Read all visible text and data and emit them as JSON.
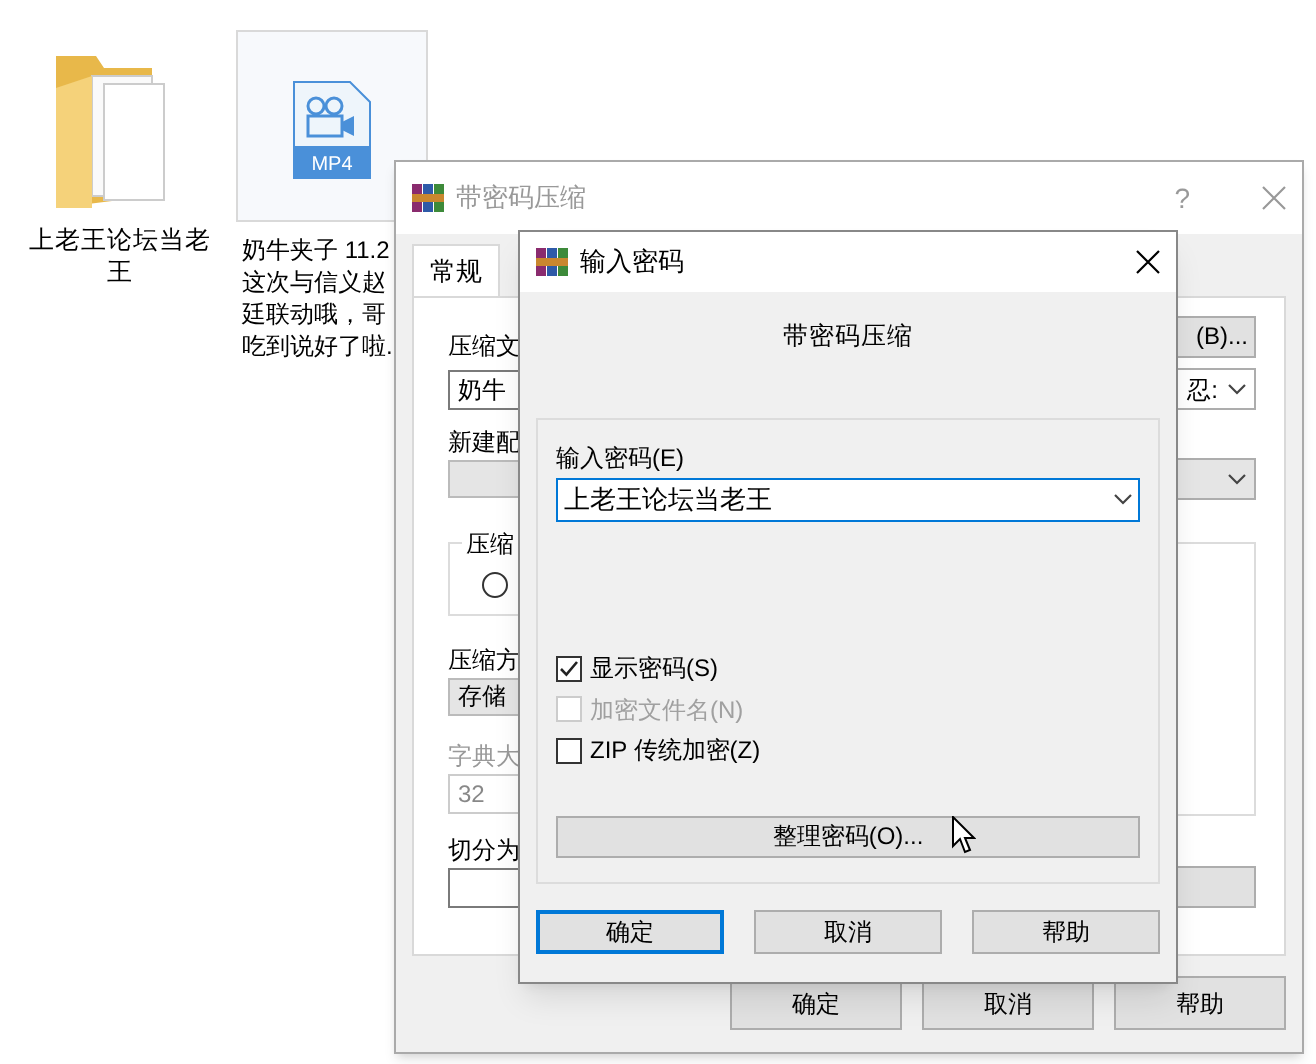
{
  "desktop": {
    "items": [
      {
        "kind": "folder",
        "label_lines": [
          "上老王论坛当老",
          "王"
        ],
        "selected": false
      },
      {
        "kind": "video",
        "badge": "MP4",
        "label_lines": [
          "奶牛夹子 11.2",
          "这次与信义赵",
          "廷联动哦，哥",
          "吃到说好了啦."
        ],
        "selected": true
      }
    ]
  },
  "back_dialog": {
    "title": "带密码压缩",
    "active": false,
    "help": "?",
    "tabs": [
      {
        "label": "常规",
        "selected": true
      }
    ],
    "left": [
      {
        "kind": "label",
        "text": "压缩文"
      },
      {
        "kind": "input",
        "value": "奶牛"
      },
      {
        "kind": "label",
        "text": "新建配"
      },
      {
        "kind": "dropdown"
      },
      {
        "kind": "group",
        "legend": "压缩",
        "selected": false
      },
      {
        "kind": "label",
        "text": "压缩方"
      },
      {
        "kind": "dropdown",
        "value": "存储"
      },
      {
        "kind": "label",
        "text": "字典大",
        "disabled": true
      },
      {
        "kind": "input",
        "value": "32",
        "disabled": true
      },
      {
        "kind": "label",
        "text": "切分为"
      },
      {
        "kind": "input"
      }
    ],
    "right": [
      {
        "kind": "button",
        "label": "(B)..."
      },
      {
        "kind": "dropdown",
        "value": "忍:"
      },
      {
        "kind": "dropdown"
      },
      {
        "kind": "group"
      },
      {
        "kind": "button"
      }
    ],
    "buttons": [
      {
        "label": "确定",
        "default": false
      },
      {
        "label": "取消",
        "default": false
      },
      {
        "label": "帮助",
        "default": false
      }
    ]
  },
  "front_dialog": {
    "title": "输入密码",
    "active": true,
    "heading": "带密码压缩",
    "password_label": "输入密码(E)",
    "password": "上老王论坛当老王",
    "options": [
      {
        "label": "显示密码(S)",
        "checked": true,
        "disabled": false
      },
      {
        "label": "加密文件名(N)",
        "checked": false,
        "disabled": true
      },
      {
        "label": "ZIP 传统加密(Z)",
        "checked": false,
        "disabled": false
      }
    ],
    "organize_button": "整理密码(O)...",
    "buttons": [
      {
        "label": "确定",
        "default": true
      },
      {
        "label": "取消",
        "default": false
      },
      {
        "label": "帮助",
        "default": false
      }
    ]
  }
}
